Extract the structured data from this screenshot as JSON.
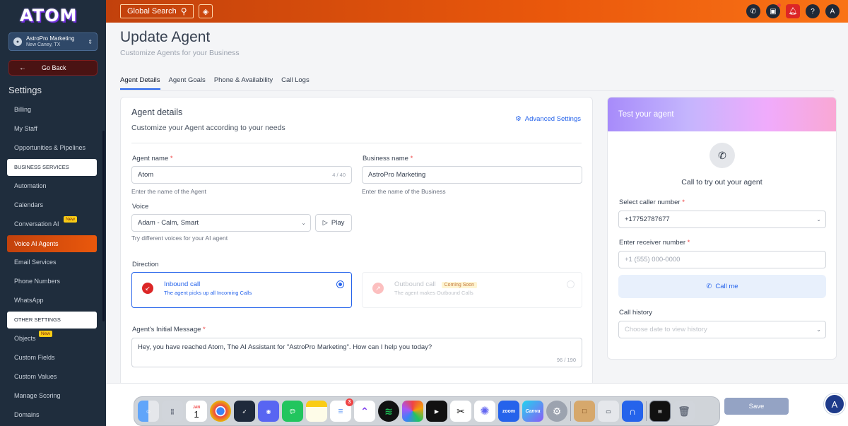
{
  "brand": {
    "logo": "ATOM"
  },
  "location": {
    "name": "AstroPro Marketing",
    "city": "New Caney, TX"
  },
  "sidebar": {
    "go_back": "Go Back",
    "title": "Settings",
    "items": [
      {
        "label": "Billing"
      },
      {
        "label": "My Staff"
      },
      {
        "label": "Opportunities & Pipelines"
      },
      {
        "label": "BUSINESS SERVICES"
      },
      {
        "label": "Automation"
      },
      {
        "label": "Calendars"
      },
      {
        "label": "Conversation AI",
        "badge": "New"
      },
      {
        "label": "Voice AI Agents"
      },
      {
        "label": "Email Services"
      },
      {
        "label": "Phone Numbers"
      },
      {
        "label": "WhatsApp"
      },
      {
        "label": "OTHER SETTINGS"
      },
      {
        "label": "Objects",
        "badge": "New"
      },
      {
        "label": "Custom Fields"
      },
      {
        "label": "Custom Values"
      },
      {
        "label": "Manage Scoring"
      },
      {
        "label": "Domains"
      }
    ]
  },
  "topbar": {
    "search_label": "Global Search"
  },
  "page": {
    "title": "Update Agent",
    "subtitle": "Customize Agents for your Business"
  },
  "tabs": [
    {
      "label": "Agent Details"
    },
    {
      "label": "Agent Goals"
    },
    {
      "label": "Phone & Availability"
    },
    {
      "label": "Call Logs"
    }
  ],
  "agent_card": {
    "title": "Agent details",
    "subtitle": "Customize your Agent according to your needs",
    "advanced": "Advanced Settings",
    "agent_name": {
      "label": "Agent name",
      "value": "Atom",
      "counter": "4 / 40",
      "help": "Enter the name of the Agent"
    },
    "business_name": {
      "label": "Business name",
      "value": "AstroPro Marketing",
      "help": "Enter the name of the Business"
    },
    "voice": {
      "label": "Voice",
      "value": "Adam - Calm, Smart",
      "play": "Play",
      "help": "Try different voices for your AI agent"
    },
    "direction": {
      "label": "Direction",
      "inbound": {
        "title": "Inbound call",
        "desc": "The agent picks up all Incoming Calls"
      },
      "outbound": {
        "title": "Outbound call",
        "badge": "Coming Soon",
        "desc": "The agent makes Outbound Calls"
      }
    },
    "initial_message": {
      "label": "Agent's Initial Message",
      "value": "Hey, you have reached Atom, The AI Assistant for \"AstroPro Marketing\". How can I help you today?",
      "counter": "96 / 190"
    }
  },
  "test_panel": {
    "title": "Test your agent",
    "caption": "Call to try out your agent",
    "caller": {
      "label": "Select caller number",
      "value": "+17752787677"
    },
    "receiver": {
      "label": "Enter receiver number",
      "placeholder": "+1 (555) 000-0000"
    },
    "call_me": "Call me",
    "history": {
      "label": "Call history",
      "placeholder": "Choose date to view history"
    }
  },
  "footer": {
    "save": "Save"
  },
  "dock": {
    "calendar_month": "JAN",
    "calendar_day": "1",
    "reminders_badge": "3",
    "apps": [
      "Finder",
      "Launchpad",
      "Calendar",
      "Chrome",
      "Rocket",
      "Discord",
      "Messages",
      "Notes",
      "Reminders",
      "ClickUp",
      "Spotify",
      "Photos",
      "Final Cut",
      "CapCut",
      "Perplexity",
      "Zoom",
      "Canva",
      "Settings",
      "Preview",
      "Screens",
      "Arc",
      "Terminal",
      "Trash"
    ],
    "zoom_label": "zoom",
    "canva_label": "Canva"
  },
  "colors": {
    "accent": "#ea580c",
    "primary": "#2563eb",
    "sidebar_bg": "#1f2d3d"
  }
}
